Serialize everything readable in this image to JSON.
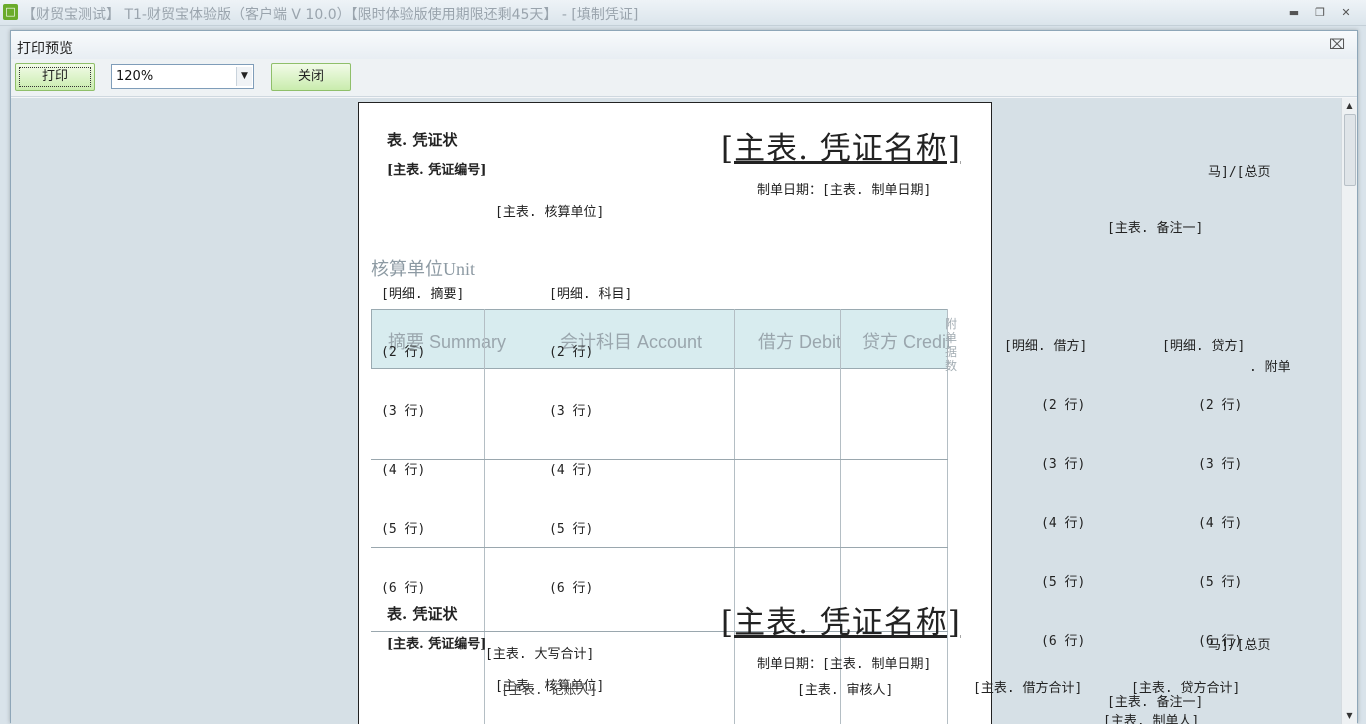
{
  "window": {
    "title": "【财贸宝测试】 T1-财贸宝体验版（客户端 V 10.0）【限时体验版使用期限还剩45天】 - [填制凭证]",
    "app_icon": "lock-app-icon"
  },
  "dialog": {
    "title": "打印预览",
    "print_label": "打印",
    "zoom_value": "120%",
    "close_label": "关闭"
  },
  "voucher": {
    "status_label": "表. 凭证状",
    "voucher_name_tpl": "[主表. 凭证名称]",
    "voucher_no_tpl": "[主表. 凭证编号]",
    "date_label": "制单日期：[主表. 制单日期]",
    "unit_tpl": "[主表. 核算单位]",
    "unit_handwritten": "核算单位Unit",
    "detail_summary": "[明细. 摘要]",
    "detail_account": "[明细. 科目]",
    "detail_debit": "[明细. 借方]",
    "detail_credit": "[明细. 贷方]",
    "page_tpl": "马]/[总页",
    "note1": "[主表. 备注一]",
    "attach": ". 附单",
    "headers": {
      "summary": "摘要 Summary",
      "account": "会计科目 Account",
      "debit": "借方 Debit",
      "credit": "贷方 Credit"
    },
    "side_label": "附单据数",
    "rows": [
      "(2 行)",
      "(3 行)",
      "(4 行)",
      "(5 行)",
      "(6 行)"
    ],
    "total_capital": "[主表. 大写合计]",
    "total_debit": "[主表. 借方合计]",
    "total_credit": "[主表. 贷方合计]",
    "bookkeeper": "[主表. 记账人]",
    "reviewer": "[主表. 审核人]",
    "maker": "[主表. 制单人]"
  }
}
